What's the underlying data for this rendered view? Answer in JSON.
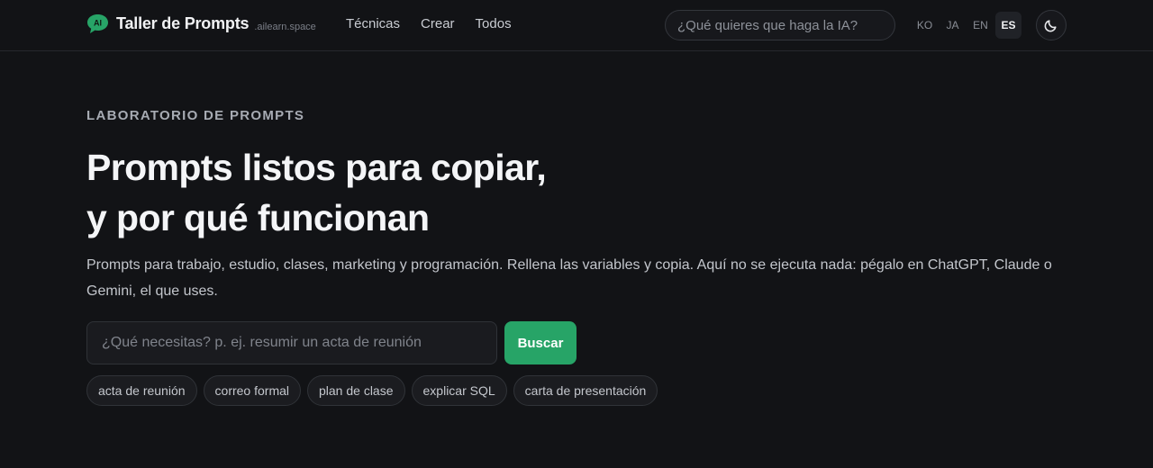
{
  "brand": {
    "logo_text": "AI",
    "name": "Taller de Prompts",
    "domain": ".ailearn.space",
    "accent_color": "#27a467"
  },
  "nav": {
    "items": [
      {
        "label": "Técnicas"
      },
      {
        "label": "Crear"
      },
      {
        "label": "Todos"
      }
    ]
  },
  "header_search": {
    "placeholder": "¿Qué quieres que haga la IA?"
  },
  "languages": {
    "items": [
      {
        "code": "KO",
        "active": false
      },
      {
        "code": "JA",
        "active": false
      },
      {
        "code": "EN",
        "active": false
      },
      {
        "code": "ES",
        "active": true
      }
    ]
  },
  "theme_toggle": {
    "icon": "moon-icon"
  },
  "hero": {
    "eyebrow": "LABORATORIO DE PROMPTS",
    "title_line1": "Prompts listos para copiar,",
    "title_line2": "y por qué funcionan",
    "subtitle": "Prompts para trabajo, estudio, clases, marketing y programación. Rellena las variables y copia. Aquí no se ejecuta nada: pégalo en ChatGPT, Claude o Gemini, el que uses.",
    "search": {
      "placeholder": "¿Qué necesitas? p. ej. resumir un acta de reunión",
      "button_label": "Buscar"
    },
    "chips": [
      "acta de reunión",
      "correo formal",
      "plan de clase",
      "explicar SQL",
      "carta de presentación"
    ]
  }
}
